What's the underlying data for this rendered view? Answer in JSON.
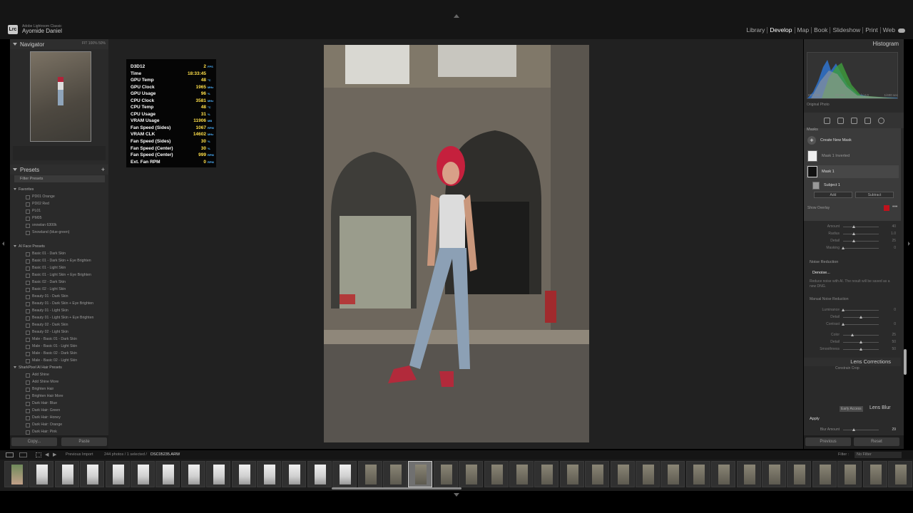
{
  "app": {
    "product": "Adobe Lightroom Classic",
    "user": "Ayomide Daniel",
    "logo": "Lrc"
  },
  "modules": [
    "Library",
    "Develop",
    "Map",
    "Book",
    "Slideshow",
    "Print",
    "Web"
  ],
  "active_module": "Develop",
  "navigator": {
    "title": "Navigator",
    "zoom": [
      "FIT",
      "100%",
      "50%"
    ]
  },
  "presets": {
    "title": "Presets",
    "filter_placeholder": "Filter Presets",
    "groups": [
      {
        "name": "Favorites",
        "items": [
          "PD01 Orange",
          "PD02 Red",
          "PL01",
          "PM05",
          "snowlan 6300k",
          "Snowland (blue-green)"
        ]
      },
      {
        "name": "AI Face Presets",
        "items": [
          "Basic 01 - Dark Skin",
          "Basic 01 - Dark Skin + Eye Brighten",
          "Basic 01 - Light Skin",
          "Basic 01 - Light Skin + Eye Brighten",
          "Basic 02 - Dark Skin",
          "Basic 02 - Light Skin",
          "Beauty 01 - Dark Skin",
          "Beauty 01 - Dark Skin + Eye Brighten",
          "Beauty 01 - Light Skin",
          "Beauty 01 - Light Skin + Eye Brighten",
          "Beauty 02 - Dark Skin",
          "Beauty 02 - Light Skin",
          "Male - Basic 01 - Dark Skin",
          "Male - Basic 01 - Light Skin",
          "Male - Basic 02 - Dark Skin",
          "Male - Basic 02 - Light Skin"
        ]
      },
      {
        "name": "SharkPixel AI Hair Presets",
        "items": [
          "Add Shine",
          "Add Shine More",
          "Brighten Hair",
          "Brighten Hair More",
          "Dark Hair: Blue",
          "Dark Hair: Green",
          "Dark Hair: Honey",
          "Dark Hair: Orange",
          "Dark Hair: Pink"
        ]
      }
    ],
    "copy_label": "Copy...",
    "paste_label": "Paste"
  },
  "osd": [
    {
      "label": "D3D12",
      "value": "2",
      "unit": "FPS"
    },
    {
      "label": "Time",
      "value": "18:33:45",
      "unit": ""
    },
    {
      "label": "GPU Temp",
      "value": "48",
      "unit": "°C"
    },
    {
      "label": "GPU Clock",
      "value": "1965",
      "unit": "MHz"
    },
    {
      "label": "GPU Usage",
      "value": "96",
      "unit": "%"
    },
    {
      "label": "CPU Clock",
      "value": "3581",
      "unit": "MHz"
    },
    {
      "label": "CPU Temp",
      "value": "48",
      "unit": "°C"
    },
    {
      "label": "CPU Usage",
      "value": "31",
      "unit": "%"
    },
    {
      "label": "VRAM Usage",
      "value": "11906",
      "unit": "MB"
    },
    {
      "label": "Fan Speed (Sides)",
      "value": "1067",
      "unit": "RPM"
    },
    {
      "label": "VRAM CLK",
      "value": "14602",
      "unit": "MHz"
    },
    {
      "label": "Fan Speed (Sides)",
      "value": "30",
      "unit": "%"
    },
    {
      "label": "Fan Speed (Center)",
      "value": "30",
      "unit": "%"
    },
    {
      "label": "Fan Speed (Center)",
      "value": "999",
      "unit": "RPM"
    },
    {
      "label": "Ext. Fan RPM",
      "value": "0",
      "unit": "RPM"
    }
  ],
  "histogram": {
    "title": "Histogram",
    "meta": [
      "ISO 400",
      "50 mm",
      "f / 2.0",
      "1/400 sec"
    ],
    "original_photo": "Original Photo"
  },
  "masks": {
    "title": "Masks",
    "create": "Create New Mask",
    "items": [
      "Mask 1 Inverted",
      "Mask 1"
    ],
    "component": "Subject 1",
    "add": "Add",
    "subtract": "Subtract",
    "show_overlay": "Show Overlay",
    "overlay_color": "#c0121c"
  },
  "detail": {
    "sharpening": [
      {
        "label": "Amount",
        "value": "40",
        "pos": 0.3
      },
      {
        "label": "Radius",
        "value": "1.0",
        "pos": 0.3
      },
      {
        "label": "Detail",
        "value": "25",
        "pos": 0.3
      },
      {
        "label": "Masking",
        "value": "0",
        "pos": 0.0
      }
    ],
    "noise_reduction": "Noise Reduction",
    "denoise": "Denoise...",
    "denoise_note": "Reduce noise with AI. The result will be saved as a new DNG.",
    "manual_nr": "Manual Noise Reduction",
    "manual": [
      {
        "label": "Luminance",
        "value": "0",
        "pos": 0.0
      },
      {
        "label": "Detail",
        "value": "",
        "pos": 0.5
      },
      {
        "label": "Contrast",
        "value": "0",
        "pos": 0.0
      },
      {
        "label": "Color",
        "value": "25",
        "pos": 0.25
      },
      {
        "label": "Detail",
        "value": "50",
        "pos": 0.5
      },
      {
        "label": "Smoothness",
        "value": "50",
        "pos": 0.5
      }
    ]
  },
  "lens": {
    "corrections": "Lens Corrections",
    "constrain": "Constrain Crop",
    "early_access": "Early Access",
    "lens_blur": "Lens Blur",
    "apply": "Apply",
    "blur_amount_label": "Blur Amount",
    "blur_amount": "29",
    "blur_pos": 0.29
  },
  "right_buttons": {
    "previous": "Previous",
    "reset": "Reset"
  },
  "filmstrip_bar": {
    "source": "Previous Import",
    "count": "244 photos / 1 selected /",
    "file": "DSC05235.ARW",
    "filter_label": "Filter :",
    "filter_value": "No Filter"
  },
  "filmstrip": {
    "count": 36,
    "selected_index": 16
  }
}
